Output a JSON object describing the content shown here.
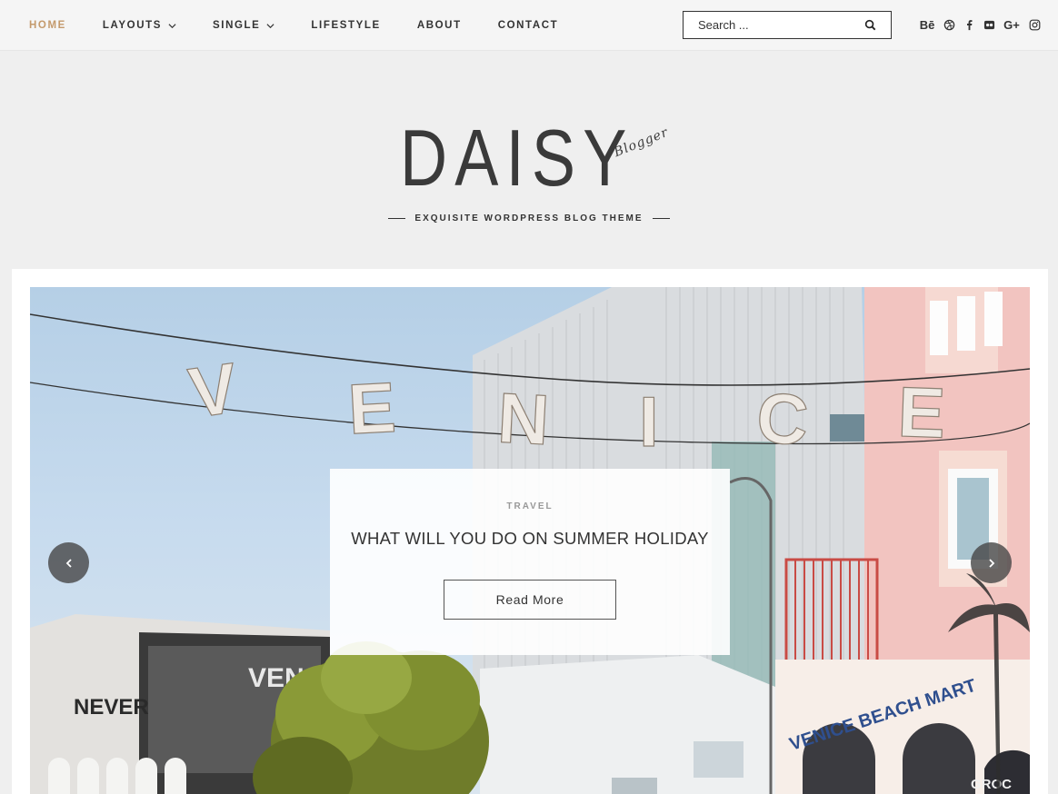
{
  "nav": {
    "items": [
      {
        "label": "HOME",
        "active": true,
        "dropdown": false
      },
      {
        "label": "LAYOUTS",
        "active": false,
        "dropdown": true
      },
      {
        "label": "SINGLE",
        "active": false,
        "dropdown": true
      },
      {
        "label": "LIFESTYLE",
        "active": false,
        "dropdown": false
      },
      {
        "label": "ABOUT",
        "active": false,
        "dropdown": false
      },
      {
        "label": "CONTACT",
        "active": false,
        "dropdown": false
      }
    ]
  },
  "search": {
    "placeholder": "Search ...",
    "icon": "search-icon"
  },
  "socials": [
    {
      "name": "behance-icon",
      "glyph": "Bē"
    },
    {
      "name": "dribbble-icon"
    },
    {
      "name": "facebook-icon"
    },
    {
      "name": "flickr-icon"
    },
    {
      "name": "google-plus-icon",
      "glyph": "G+"
    },
    {
      "name": "instagram-icon"
    }
  ],
  "logo": {
    "main": "DAISY",
    "script": "Blogger"
  },
  "tagline": "EXQUISITE WORDPRESS BLOG THEME",
  "slider": {
    "category": "TRAVEL",
    "title": "WHAT WILL YOU DO ON SUMMER HOLIDAY",
    "button_label": "Read More",
    "sign_letters": [
      "V",
      "E",
      "N",
      "I",
      "C",
      "E"
    ],
    "mural_texts": [
      "NEVER",
      "VEN",
      "VENICE BEACH MART",
      "GROC"
    ]
  },
  "colors": {
    "accent": "#c49a6c",
    "text": "#333333",
    "header_bg": "#efefef",
    "topbar_bg": "#f5f5f5"
  }
}
